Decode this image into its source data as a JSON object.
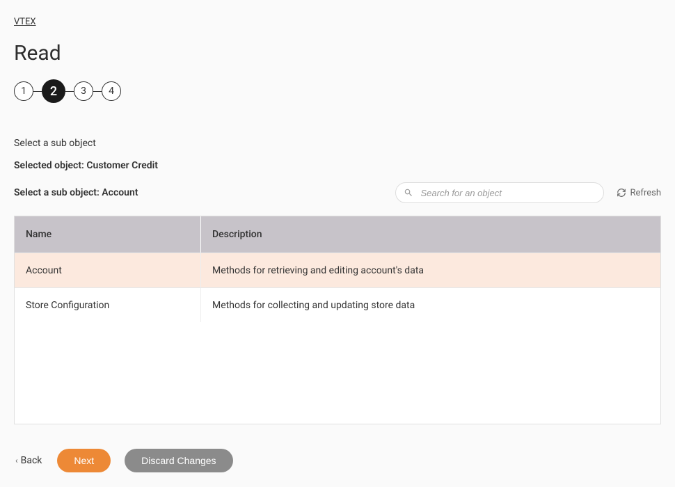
{
  "breadcrumb": "VTEX",
  "page_title": "Read",
  "stepper": {
    "steps": [
      "1",
      "2",
      "3",
      "4"
    ],
    "active_index": 1
  },
  "subtitle": "Select a sub object",
  "selected_object_label": "Selected object: Customer Credit",
  "select_sub_label": "Select a sub object: Account",
  "search": {
    "placeholder": "Search for an object"
  },
  "refresh_label": "Refresh",
  "table": {
    "headers": {
      "name": "Name",
      "description": "Description"
    },
    "rows": [
      {
        "name": "Account",
        "description": "Methods for retrieving and editing account's data",
        "selected": true
      },
      {
        "name": "Store Configuration",
        "description": "Methods for collecting and updating store data",
        "selected": false
      }
    ]
  },
  "footer": {
    "back": "Back",
    "next": "Next",
    "discard": "Discard Changes"
  }
}
